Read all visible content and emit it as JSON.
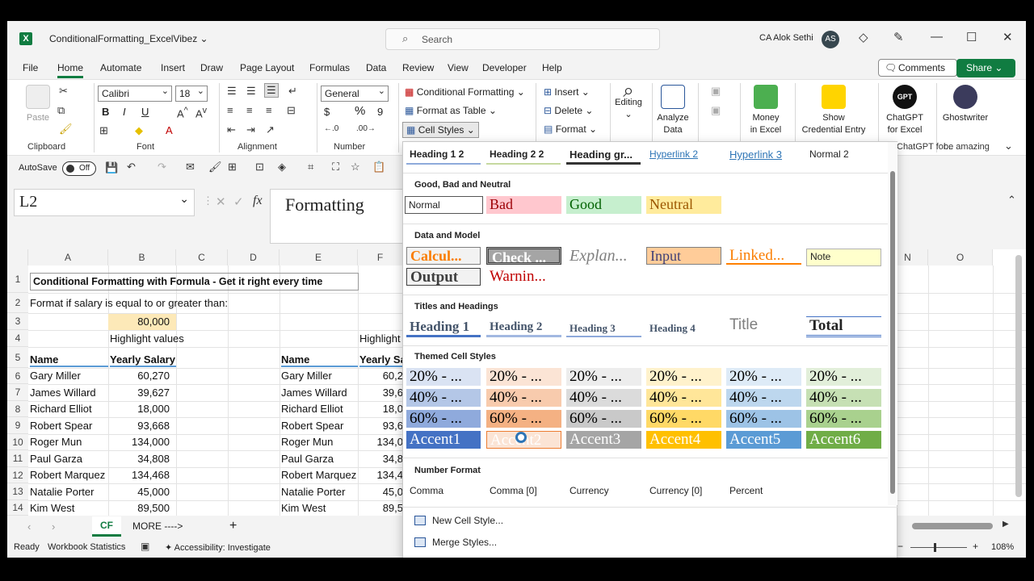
{
  "titlebar": {
    "filename": "ConditionalFormatting_ExcelVibez",
    "search_placeholder": "Search",
    "user": "CA Alok Sethi",
    "avatar_initials": "AS"
  },
  "menu": {
    "items": [
      "File",
      "Home",
      "Automate",
      "Insert",
      "Draw",
      "Page Layout",
      "Formulas",
      "Data",
      "Review",
      "View",
      "Developer",
      "Help"
    ],
    "comments": "Comments",
    "share": "Share"
  },
  "ribbon": {
    "clipboard": {
      "paste": "Paste",
      "label": "Clipboard"
    },
    "font": {
      "name": "Calibri",
      "size": "18",
      "label": "Font",
      "bold": "B",
      "italic": "I",
      "underline": "U"
    },
    "alignment": {
      "label": "Alignment"
    },
    "number": {
      "format": "General",
      "label": "Number",
      "currency": "$",
      "percent": "%",
      "comma": "9"
    },
    "styles": {
      "conditional": "Conditional Formatting",
      "format_table": "Format as Table",
      "cell_styles": "Cell Styles"
    },
    "cells": {
      "insert": "Insert",
      "delete": "Delete",
      "format": "Format"
    },
    "editing": "Editing",
    "analyze": [
      "Analyze",
      "Data"
    ],
    "money": [
      "Money",
      "in Excel"
    ],
    "show_cred": [
      "Show",
      "Credential Entry"
    ],
    "chatgpt": [
      "ChatGPT",
      "for Excel"
    ],
    "chatgpt_sub": "ChatGPT for...",
    "ghostwriter": "Ghostwriter",
    "ghost_sub": "be amazing",
    "gpt_badge": "GPT"
  },
  "qat": {
    "autosave": "AutoSave",
    "toggle": "Off"
  },
  "formula": {
    "namebox": "L2",
    "content": "Formatting",
    "fx": "fx"
  },
  "grid": {
    "columns": [
      "A",
      "B",
      "C",
      "D",
      "E",
      "F",
      "N",
      "O"
    ],
    "rows": [
      "1",
      "2",
      "3",
      "4",
      "5",
      "6",
      "7",
      "8",
      "9",
      "10",
      "11",
      "12",
      "13",
      "14"
    ],
    "title": "Conditional Formatting with Formula - Get it right every time",
    "prompt": "Format if salary is equal to or greater than:",
    "threshold": "80,000",
    "highlight": "Highlight values",
    "highlight_f": "Highlight",
    "hdr_name": "Name",
    "hdr_salary": "Yearly Salary",
    "hdr_salary_f": "Yearly Sa",
    "names": [
      "Gary Miller",
      "James Willard",
      "Richard Elliot",
      "Robert Spear",
      "Roger Mun",
      "Paul Garza",
      "Robert Marquez",
      "Natalie Porter",
      "Kim West"
    ],
    "salaries": [
      "60,270",
      "39,627",
      "18,000",
      "93,668",
      "134,000",
      "34,808",
      "134,468",
      "45,000",
      "89,500"
    ],
    "salaries_f": [
      "60,2",
      "39,6",
      "18,0",
      "93,6",
      "134,0",
      "34,8",
      "134,4",
      "45,0",
      "89,5"
    ]
  },
  "tabs": {
    "active": "CF",
    "other": "MORE ---->",
    "add": "+"
  },
  "status": {
    "ready": "Ready",
    "stats": "Workbook Statistics",
    "access": "Accessibility: Investigate",
    "zoom": "108%"
  },
  "dropdown": {
    "top_row": [
      "Heading 1 2",
      "Heading 2 2",
      "Heading gr...",
      "Hyperlink 2",
      "Hyperlink 3",
      "Normal 2"
    ],
    "good_bad": {
      "title": "Good, Bad and Neutral",
      "items": [
        "Normal",
        "Bad",
        "Good",
        "Neutral"
      ]
    },
    "data_model": {
      "title": "Data and Model",
      "row1": [
        "Calcul...",
        "Check ...",
        "Explan...",
        "Input",
        "Linked...",
        "Note"
      ],
      "row2": [
        "Output",
        "Warnin..."
      ]
    },
    "titles": {
      "title": "Titles and Headings",
      "items": [
        "Heading 1",
        "Heading 2",
        "Heading 3",
        "Heading 4",
        "Title",
        "Total"
      ]
    },
    "themed": {
      "title": "Themed Cell Styles",
      "pct20": "20% - ...",
      "pct40": "40% - ...",
      "pct60": "60% - ...",
      "accents": [
        "Accent1",
        "Accent2",
        "Accent3",
        "Accent4",
        "Accent5",
        "Accent6"
      ]
    },
    "number": {
      "title": "Number Format",
      "items": [
        "Comma",
        "Comma [0]",
        "Currency",
        "Currency [0]",
        "Percent"
      ]
    },
    "actions": [
      "New Cell Style...",
      "Merge Styles..."
    ]
  }
}
